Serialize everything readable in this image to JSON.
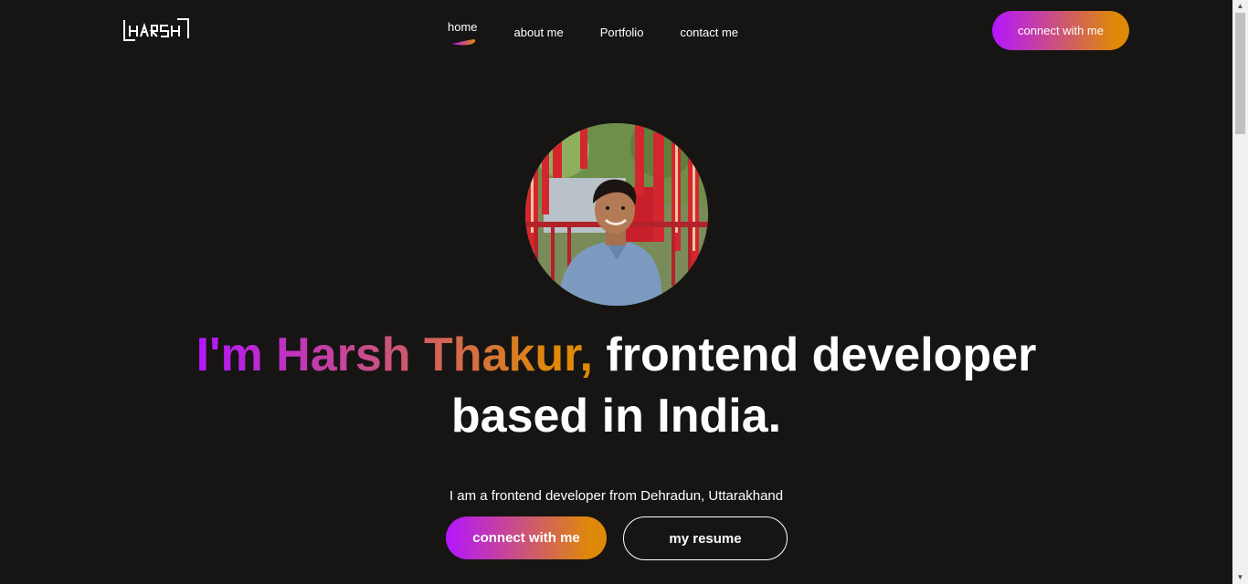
{
  "logo": {
    "text": "HARSH"
  },
  "nav": {
    "items": [
      {
        "label": "home",
        "active": true
      },
      {
        "label": "about me",
        "active": false
      },
      {
        "label": "Portfolio",
        "active": false
      },
      {
        "label": "contact me",
        "active": false
      }
    ],
    "connect_label": "connect with me"
  },
  "hero": {
    "title_highlight": "I'm Harsh Thakur,",
    "title_rest_1": " frontend developer",
    "title_rest_2": "based in India.",
    "subtitle": "I am a frontend developer from Dehradun, Uttarakhand",
    "primary_button": "connect with me",
    "secondary_button": "my resume"
  },
  "colors": {
    "background": "#161513",
    "gradient_start": "#B415FF",
    "gradient_end": "#DF8908"
  },
  "icons": {
    "scroll_up": "arrow-up-icon",
    "scroll_down": "arrow-down-icon"
  }
}
